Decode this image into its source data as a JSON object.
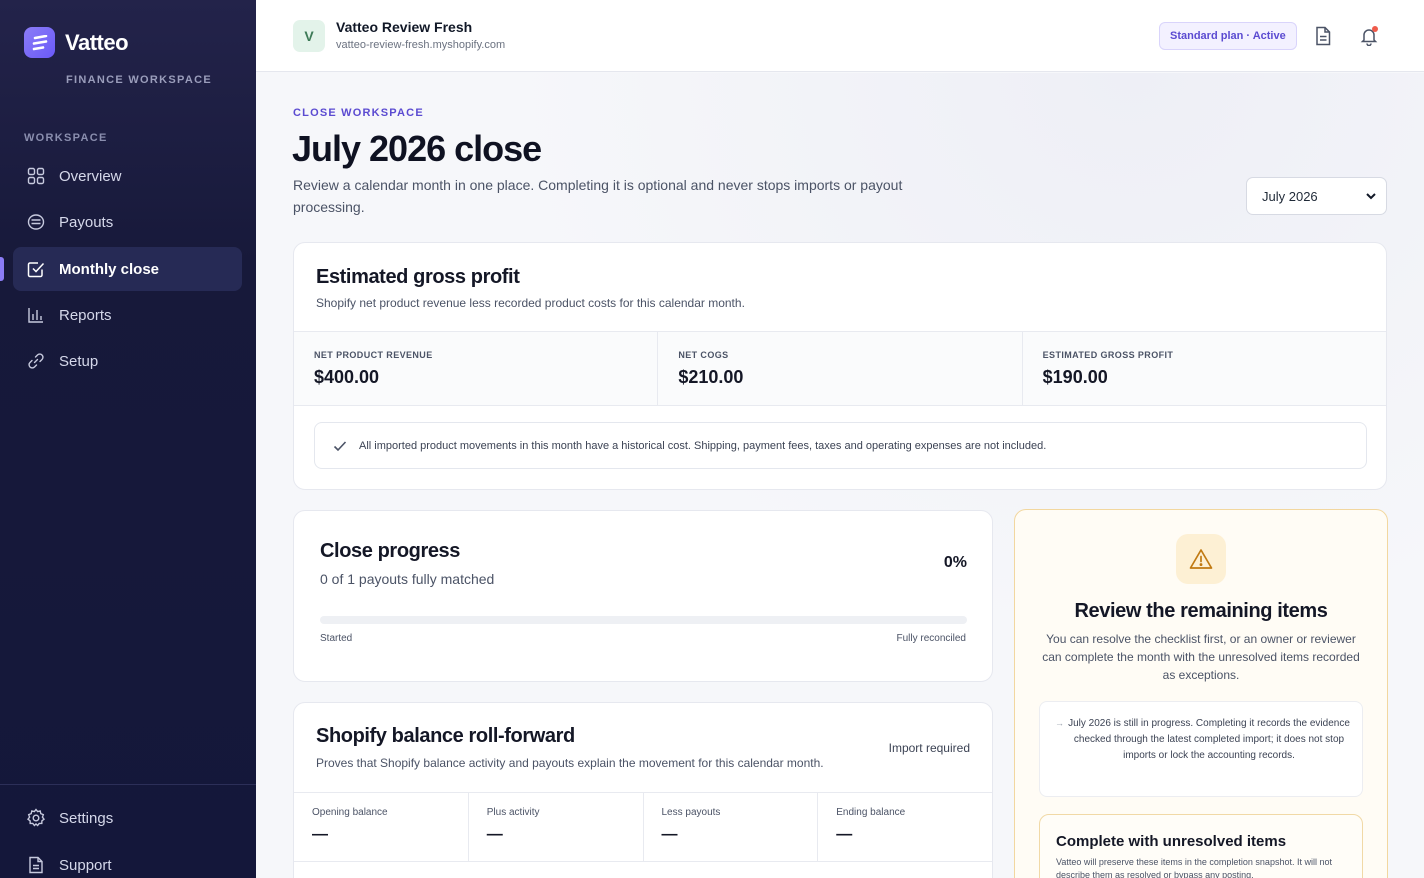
{
  "sidebar": {
    "brand_name": "Vatteo",
    "brand_subtitle": "FINANCE WORKSPACE",
    "section_label": "WORKSPACE",
    "nav": [
      {
        "label": "Overview",
        "icon": "grid-icon"
      },
      {
        "label": "Payouts",
        "icon": "coins-icon"
      },
      {
        "label": "Monthly close",
        "icon": "checkbox-icon",
        "active": true
      },
      {
        "label": "Reports",
        "icon": "bar-chart-icon"
      },
      {
        "label": "Setup",
        "icon": "link-icon"
      }
    ],
    "footer": [
      {
        "label": "Settings",
        "icon": "gear-icon"
      },
      {
        "label": "Support",
        "icon": "document-icon"
      }
    ]
  },
  "header": {
    "store_initial": "V",
    "store_name": "Vatteo Review Fresh",
    "store_url": "vatteo-review-fresh.myshopify.com",
    "plan_badge": "Standard plan · Active"
  },
  "page": {
    "eyebrow": "CLOSE WORKSPACE",
    "title": "July 2026 close",
    "description": "Review a calendar month in one place. Completing it is optional and never stops imports or payout processing.",
    "month_selected": "July 2026"
  },
  "gross_profit": {
    "title": "Estimated gross profit",
    "subtitle": "Shopify net product revenue less recorded product costs for this calendar month.",
    "metrics": [
      {
        "label": "NET PRODUCT REVENUE",
        "value": "$400.00"
      },
      {
        "label": "NET COGS",
        "value": "$210.00"
      },
      {
        "label": "ESTIMATED GROSS PROFIT",
        "value": "$190.00"
      }
    ],
    "note": "All imported product movements in this month have a historical cost. Shipping, payment fees, taxes and operating expenses are not included."
  },
  "close_progress": {
    "title": "Close progress",
    "subtitle": "0 of 1 payouts fully matched",
    "percent_label": "0%",
    "progress_fraction": 0,
    "start_label": "Started",
    "end_label": "Fully reconciled"
  },
  "roll_forward": {
    "title": "Shopify balance roll-forward",
    "subtitle": "Proves that Shopify balance activity and payouts explain the movement for this calendar month.",
    "status": "Import required",
    "cells": [
      {
        "label": "Opening balance",
        "value": "—"
      },
      {
        "label": "Plus activity",
        "value": "—"
      },
      {
        "label": "Less payouts",
        "value": "—"
      },
      {
        "label": "Ending balance",
        "value": "—"
      }
    ]
  },
  "review": {
    "title": "Review the remaining items",
    "body": "You can resolve the checklist first, or an owner or reviewer can complete the month with the unresolved items recorded as exceptions.",
    "inner_text": "July 2026 is still in progress. Completing it records the evidence checked through the latest completed import; it does not stop imports or lock the accounting records.",
    "complete_title": "Complete with unresolved items",
    "complete_text": "Vatteo will preserve these items in the completion snapshot. It will not describe them as resolved or bypass any posting."
  },
  "colors": {
    "accent": "#6a5af9",
    "sidebar_bg": "#17193a",
    "warning_border": "#f2d79f"
  }
}
